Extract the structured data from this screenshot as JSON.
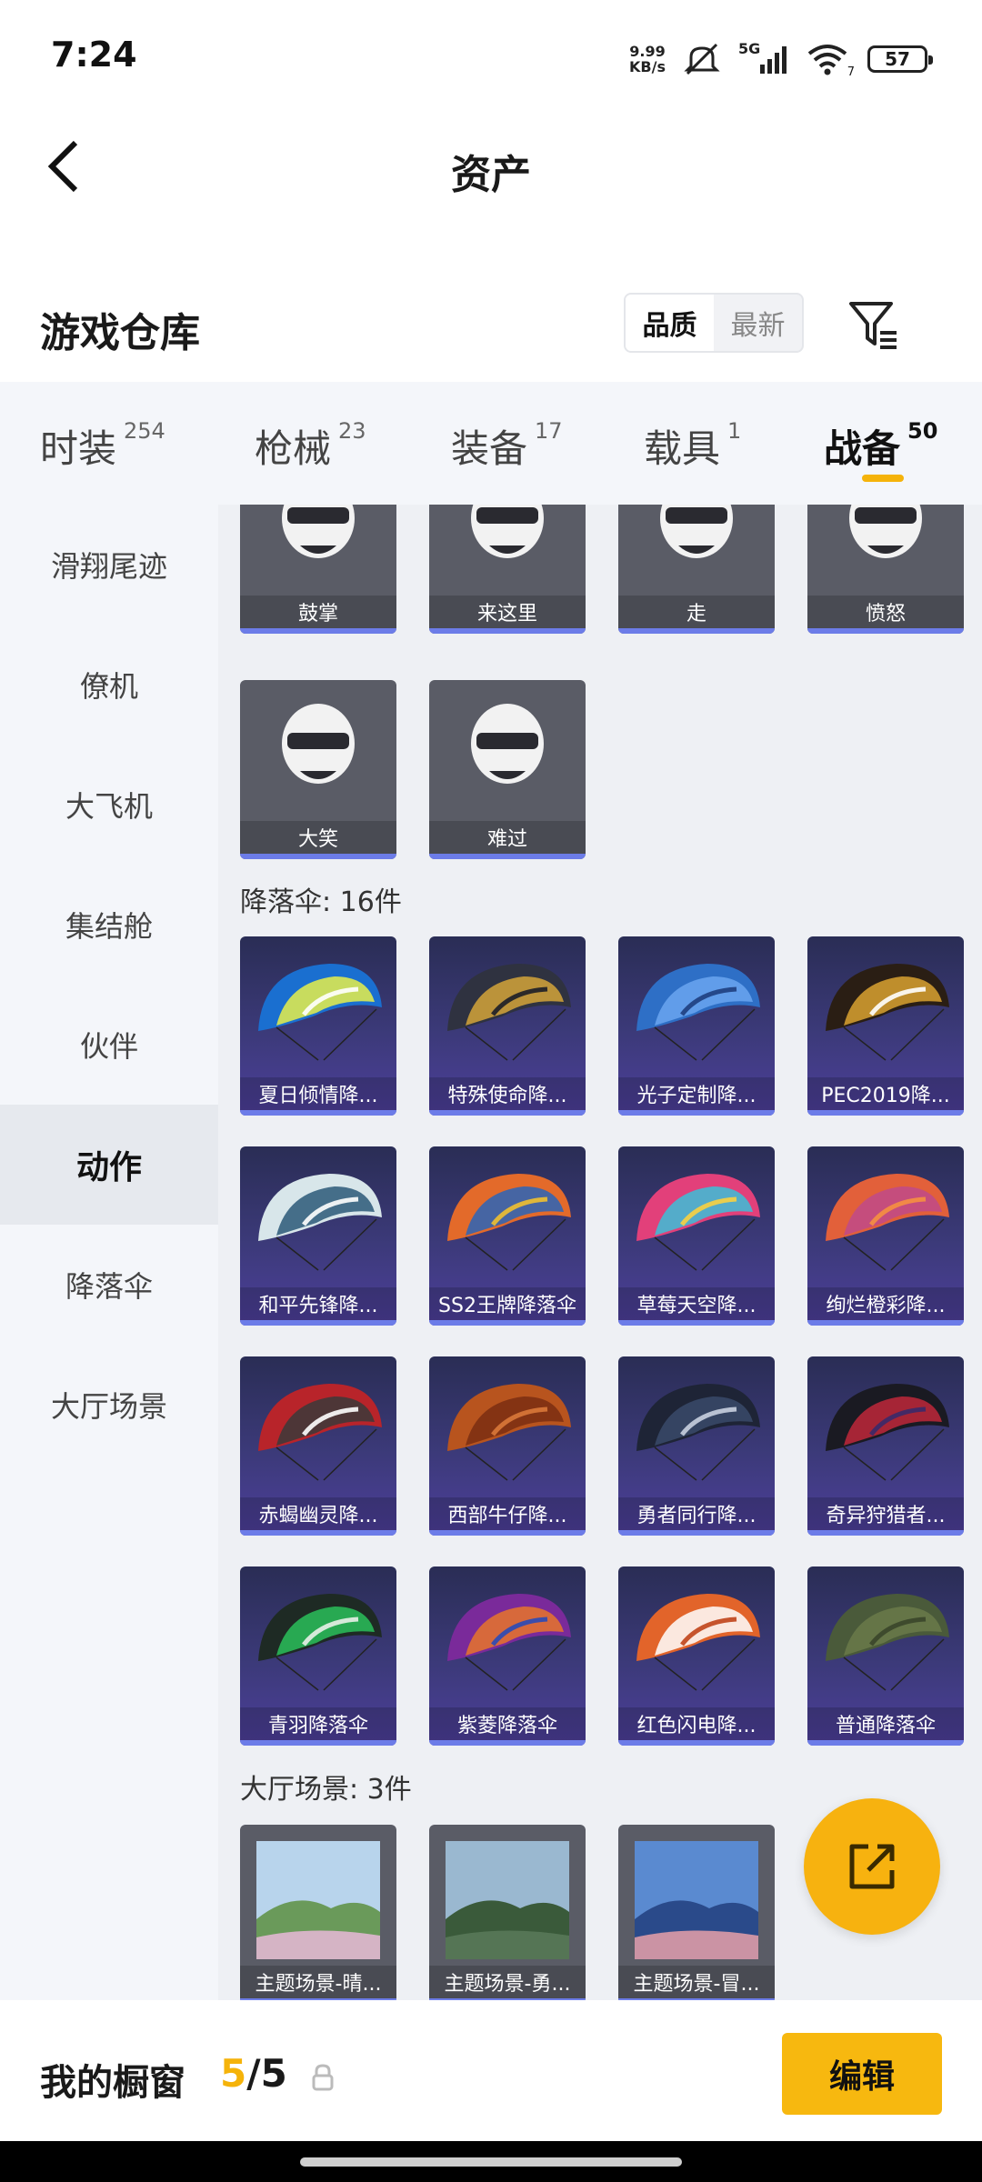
{
  "status_bar": {
    "time": "7:24",
    "net_speed_value": "9.99",
    "net_speed_unit": "KB/s",
    "battery": "57",
    "wifi_badge": "7",
    "network": "5G"
  },
  "header": {
    "title": "资产"
  },
  "warehouse": {
    "title": "游戏仓库",
    "sort": [
      {
        "label": "品质",
        "active": true
      },
      {
        "label": "最新",
        "active": false
      }
    ]
  },
  "categories": [
    {
      "label": "时装",
      "count": "254",
      "active": false
    },
    {
      "label": "枪械",
      "count": "23",
      "active": false
    },
    {
      "label": "装备",
      "count": "17",
      "active": false
    },
    {
      "label": "载具",
      "count": "1",
      "active": false
    },
    {
      "label": "战备",
      "count": "50",
      "active": true
    }
  ],
  "sidebar": [
    {
      "label": "滑翔尾迹",
      "active": false
    },
    {
      "label": "僚机",
      "active": false
    },
    {
      "label": "大飞机",
      "active": false
    },
    {
      "label": "集结舱",
      "active": false
    },
    {
      "label": "伙伴",
      "active": false
    },
    {
      "label": "动作",
      "active": true
    },
    {
      "label": "降落伞",
      "active": false
    },
    {
      "label": "大厅场景",
      "active": false
    }
  ],
  "actions": [
    {
      "name": "鼓掌",
      "icon": "clap-icon"
    },
    {
      "name": "来这里",
      "icon": "come-here-icon"
    },
    {
      "name": "走",
      "icon": "point-icon"
    },
    {
      "name": "愤怒",
      "icon": "angry-icon"
    },
    {
      "name": "大笑",
      "icon": "laugh-icon"
    },
    {
      "name": "难过",
      "icon": "sad-icon"
    }
  ],
  "parachute_section": {
    "label": "降落伞: 16件"
  },
  "parachutes": [
    {
      "name": "夏日倾情降...",
      "colors": [
        "#1a6fd0",
        "#e8f04a",
        "#ffffff"
      ]
    },
    {
      "name": "特殊使命降...",
      "colors": [
        "#2f3240",
        "#d4a43a",
        "#1c1e28"
      ]
    },
    {
      "name": "光子定制降...",
      "colors": [
        "#2e6fc6",
        "#6aa6f0",
        "#1f3f80"
      ]
    },
    {
      "name": "PEC2019降...",
      "colors": [
        "#2a1e14",
        "#d9a230",
        "#ffffff"
      ]
    },
    {
      "name": "和平先锋降...",
      "colors": [
        "#d8e6ea",
        "#2c5878",
        "#ffffff"
      ]
    },
    {
      "name": "SS2王牌降落伞",
      "colors": [
        "#e36a2a",
        "#2a64b8",
        "#f0c030"
      ]
    },
    {
      "name": "草莓天空降...",
      "colors": [
        "#e2407a",
        "#3bc0d8",
        "#f8d040"
      ]
    },
    {
      "name": "绚烂橙彩降...",
      "colors": [
        "#e2603a",
        "#c04a8a",
        "#f59040"
      ]
    },
    {
      "name": "赤蝎幽灵降...",
      "colors": [
        "#b8242a",
        "#3a3a3a",
        "#ffffff"
      ]
    },
    {
      "name": "西部牛仔降...",
      "colors": [
        "#b8541e",
        "#7a2e12",
        "#d9783a"
      ]
    },
    {
      "name": "勇者同行降...",
      "colors": [
        "#1e2436",
        "#3a4a6a",
        "#c8d0e0"
      ]
    },
    {
      "name": "奇异狩猎者...",
      "colors": [
        "#1a1a22",
        "#c0283a",
        "#3a2a6a"
      ]
    },
    {
      "name": "青羽降落伞",
      "colors": [
        "#1e2a24",
        "#2ac05a",
        "#e8f0e8"
      ]
    },
    {
      "name": "紫菱降落伞",
      "colors": [
        "#7a2a9a",
        "#e8742a",
        "#2a4ab8"
      ]
    },
    {
      "name": "红色闪电降...",
      "colors": [
        "#e2642a",
        "#ffffff",
        "#c0441a"
      ]
    },
    {
      "name": "普通降落伞",
      "colors": [
        "#4a5a3a",
        "#6a7a4a",
        "#3a462a"
      ]
    }
  ],
  "scene_section": {
    "label": "大厅场景: 3件"
  },
  "scenes": [
    {
      "name": "主题场景-晴...",
      "colors": [
        "#b8d4ec",
        "#e8b8d8",
        "#6a9a5a"
      ]
    },
    {
      "name": "主题场景-勇...",
      "colors": [
        "#9ab8d0",
        "#5a7a5a",
        "#3a5a3a"
      ]
    },
    {
      "name": "主题场景-冒...",
      "colors": [
        "#5a8ad0",
        "#e8a0a8",
        "#2a4a8a"
      ]
    }
  ],
  "bottom_bar": {
    "label": "我的橱窗",
    "current": "5",
    "separator": "/",
    "total": "5",
    "edit_label": "编辑"
  },
  "accent_color": "#f5b30a"
}
